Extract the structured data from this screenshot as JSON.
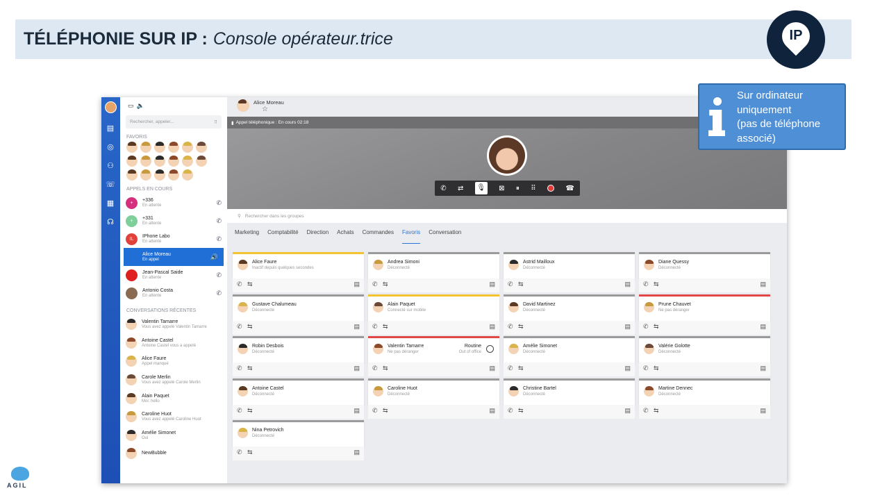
{
  "slide": {
    "title_bold": "TÉLÉPHONIE SUR IP :",
    "title_italic": "Console opérateur.trice",
    "logo_text": "IP",
    "callout_lines": [
      "Sur ordinateur",
      "uniquement",
      "(pas de téléphone",
      "associé)"
    ],
    "brand_text": "AGIL",
    "brand_colors": {
      "banner": "#dde8f3",
      "logo": "#10233d",
      "callout": "#4f8fd6"
    }
  },
  "sidebar": {
    "search_placeholder": "Rechercher, appeler...",
    "favorites_title": "FAVORIS",
    "favorites_count": 17,
    "calls_title": "APPELS EN COURS",
    "calls": [
      {
        "name": "+336",
        "status": "En attente",
        "badge": "+",
        "color": "#d4307e"
      },
      {
        "name": "+331",
        "status": "En attente",
        "badge": "+",
        "color": "#7ecf9a"
      },
      {
        "name": "IPhone Labo",
        "status": "En attente",
        "badge": "IL",
        "color": "#e0413b"
      },
      {
        "name": "Alice Moreau",
        "status": "En appel",
        "badge": "",
        "color": "#1f6fd6"
      },
      {
        "name": "Jean-Pascal Saide",
        "status": "En attente",
        "badge": "",
        "color": "#e02020"
      },
      {
        "name": "Antonio Costa",
        "status": "En attente",
        "badge": "",
        "color": "#8a6a50"
      }
    ],
    "recent_title": "CONVERSATIONS RÉCENTES",
    "recent": [
      {
        "name": "Valentin Tamarre",
        "sub": "Vous avez appelé Valentin Tamarre"
      },
      {
        "name": "Antoine Castel",
        "sub": "Antoine Castel vous a appelé"
      },
      {
        "name": "Alice Faure",
        "sub": "Appel manqué"
      },
      {
        "name": "Carole Merlin",
        "sub": "Vous avez appelé Carole Merlin"
      },
      {
        "name": "Alain Paquet",
        "sub": "Moi: hello"
      },
      {
        "name": "Caroline Huot",
        "sub": "Vous avez appelé Caroline Huot"
      },
      {
        "name": "Amélie Simonet",
        "sub": "Oui"
      },
      {
        "name": "NewBubble",
        "sub": ""
      }
    ]
  },
  "call": {
    "contact_name": "Alice Moreau",
    "status_bar": "Appel téléphonique : En cours  02:18",
    "group_search_placeholder": "Rechercher dans les groupes"
  },
  "tabs": [
    "Marketing",
    "Comptabilité",
    "Direction",
    "Achats",
    "Commandes",
    "Favoris",
    "Conversation"
  ],
  "active_tab": "Favoris",
  "contacts": [
    {
      "name": "Alice Faure",
      "status": "Inactif depuis quelques secondes",
      "bar": "#f3c332"
    },
    {
      "name": "Andrea Simoni",
      "status": "Déconnecté",
      "bar": "#9a9a9a"
    },
    {
      "name": "Astrid Mailloux",
      "status": "Déconnecté",
      "bar": "#9a9a9a"
    },
    {
      "name": "Diane Quessy",
      "status": "Déconnecté",
      "bar": "#9a9a9a"
    },
    {
      "name": "Gustave Chalumeau",
      "status": "Déconnecté",
      "bar": "#9a9a9a"
    },
    {
      "name": "Alain Paquet",
      "status": "Connecté sur mobile",
      "bar": "#f3c332"
    },
    {
      "name": "David Martinez",
      "status": "Déconnecté",
      "bar": "#9a9a9a"
    },
    {
      "name": "Prune Chauvet",
      "status": "Ne pas déranger",
      "bar": "#e04848"
    },
    {
      "name": "Robin Desbois",
      "status": "Déconnecté",
      "bar": "#9a9a9a"
    },
    {
      "name": "Valentin Tamarre",
      "status": "Ne pas déranger",
      "bar": "#e04848",
      "extra": "Routine",
      "extra2": "Out of office"
    },
    {
      "name": "Amélie Simonet",
      "status": "Déconnecté",
      "bar": "#9a9a9a"
    },
    {
      "name": "Valérie Golotte",
      "status": "Déconnecté",
      "bar": "#9a9a9a"
    },
    {
      "name": "Antoine Castel",
      "status": "Déconnecté",
      "bar": "#9a9a9a"
    },
    {
      "name": "Caroline Huot",
      "status": "Déconnecté",
      "bar": "#9a9a9a"
    },
    {
      "name": "Christine Bartel",
      "status": "Déconnecté",
      "bar": "#9a9a9a"
    },
    {
      "name": "Martine Dennec",
      "status": "Déconnecté",
      "bar": "#9a9a9a"
    },
    {
      "name": "Nina Petrovich",
      "status": "Déconnecté",
      "bar": "#9a9a9a"
    }
  ]
}
